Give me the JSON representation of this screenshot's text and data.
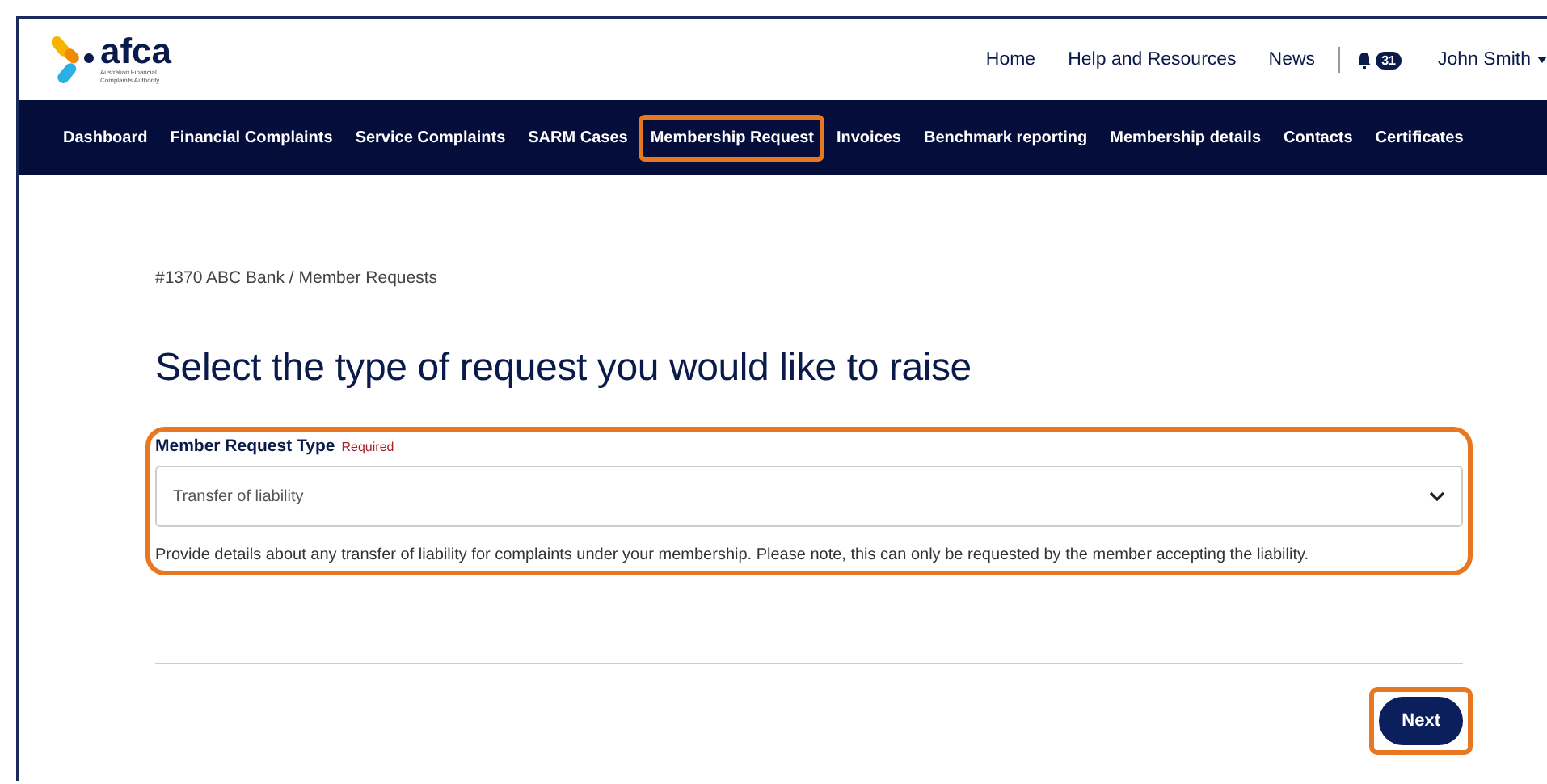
{
  "logo": {
    "wordmark": "afca",
    "tagline": "Australian Financial Complaints Authority"
  },
  "top_links": [
    {
      "label": "Home"
    },
    {
      "label": "Help and Resources"
    },
    {
      "label": "News"
    }
  ],
  "notifications": {
    "count": "31"
  },
  "user": {
    "name": "John Smith"
  },
  "nav": [
    {
      "label": "Dashboard",
      "highlighted": false
    },
    {
      "label": "Financial Complaints",
      "highlighted": false
    },
    {
      "label": "Service Complaints",
      "highlighted": false
    },
    {
      "label": "SARM Cases",
      "highlighted": false
    },
    {
      "label": "Membership Request",
      "highlighted": true
    },
    {
      "label": "Invoices",
      "highlighted": false
    },
    {
      "label": "Benchmark reporting",
      "highlighted": false
    },
    {
      "label": "Membership details",
      "highlighted": false
    },
    {
      "label": "Contacts",
      "highlighted": false
    },
    {
      "label": "Certificates",
      "highlighted": false
    }
  ],
  "breadcrumb": "#1370 ABC Bank / Member Requests",
  "heading": "Select the type of request you would like to raise",
  "field": {
    "label": "Member Request Type",
    "required": "Required",
    "value": "Transfer of liability",
    "help": "Provide details about any transfer of liability for complaints under your membership. Please note, this can only be requested by the member accepting the liability.",
    "highlighted": true
  },
  "next_button": {
    "label": "Next",
    "highlighted": true
  }
}
